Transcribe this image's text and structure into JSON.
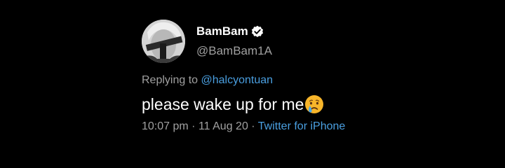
{
  "tweet": {
    "display_name": "BamBam",
    "handle": "@BamBam1A",
    "verified": true,
    "replying_prefix": "Replying to",
    "replying_user": "@halcyontuan",
    "text": "please wake up for me",
    "emoji": "crying-face",
    "time": "10:07 pm",
    "separator": "·",
    "date": "11 Aug 20",
    "source": "Twitter for iPhone"
  },
  "colors": {
    "background": "#000000",
    "primary_text": "#ffffff",
    "secondary_text": "#a0a0a0",
    "link": "#4a9fe0"
  }
}
